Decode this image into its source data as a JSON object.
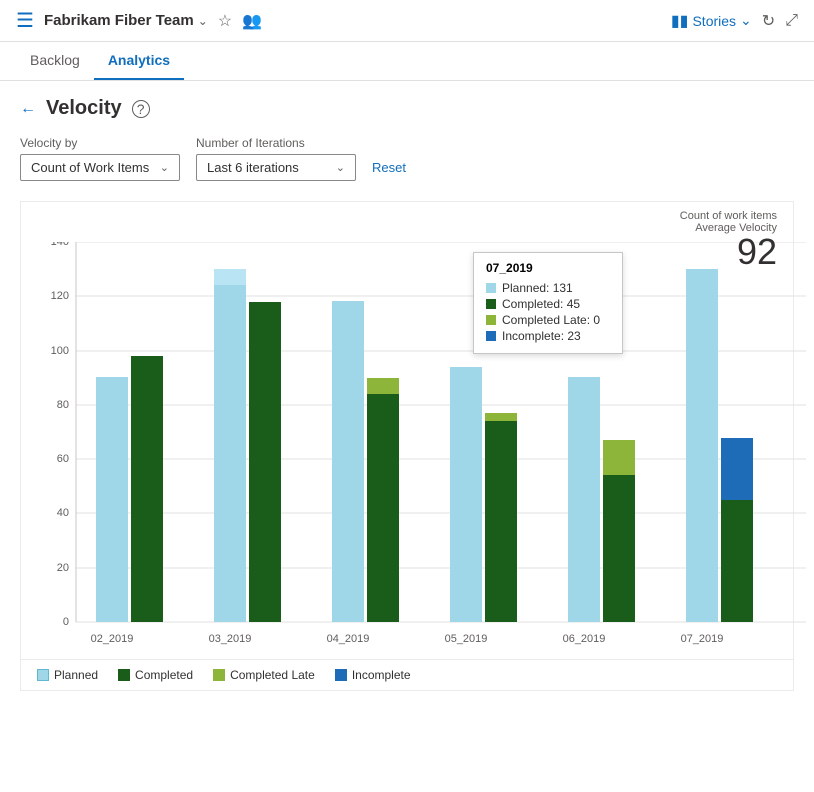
{
  "header": {
    "icon": "≡",
    "team_name": "Fabrikam Fiber Team",
    "stories_label": "Stories",
    "chevron": "∨"
  },
  "nav": {
    "tabs": [
      {
        "id": "backlog",
        "label": "Backlog",
        "active": false
      },
      {
        "id": "analytics",
        "label": "Analytics",
        "active": true
      }
    ]
  },
  "page": {
    "title": "Velocity",
    "velocity_by_label": "Velocity by",
    "velocity_by_value": "Count of Work Items",
    "iterations_label": "Number of Iterations",
    "iterations_value": "Last 6 iterations",
    "reset_label": "Reset",
    "count_label": "Count of work items",
    "avg_velocity_label": "Average Velocity",
    "avg_velocity_value": "92"
  },
  "tooltip": {
    "title": "07_2019",
    "planned_label": "Planned: 131",
    "completed_label": "Completed: 45",
    "completed_late_label": "Completed Late: 0",
    "incomplete_label": "Incomplete: 23"
  },
  "legend": {
    "items": [
      {
        "id": "planned",
        "label": "Planned",
        "color": "#9fd6e8"
      },
      {
        "id": "completed",
        "label": "Completed",
        "color": "#1a5c1a"
      },
      {
        "id": "completed_late",
        "label": "Completed Late",
        "color": "#8db53a"
      },
      {
        "id": "incomplete",
        "label": "Incomplete",
        "color": "#1e6bb8"
      }
    ]
  },
  "chart": {
    "x_labels": [
      "02_2019",
      "03_2019",
      "04_2019",
      "05_2019",
      "06_2019",
      "07_2019"
    ],
    "y_ticks": [
      0,
      20,
      40,
      60,
      80,
      100,
      120,
      140
    ],
    "series": {
      "planned": [
        90,
        130,
        118,
        94,
        90,
        130
      ],
      "completed": [
        98,
        118,
        84,
        74,
        54,
        45
      ],
      "completed_late": [
        0,
        0,
        6,
        3,
        13,
        0
      ],
      "incomplete": [
        0,
        0,
        0,
        0,
        0,
        23
      ]
    }
  },
  "colors": {
    "planned": "#9fd6e8",
    "completed": "#1a5c1a",
    "completed_late": "#8db53a",
    "incomplete": "#1e6bb8",
    "accent": "#106ebe"
  }
}
